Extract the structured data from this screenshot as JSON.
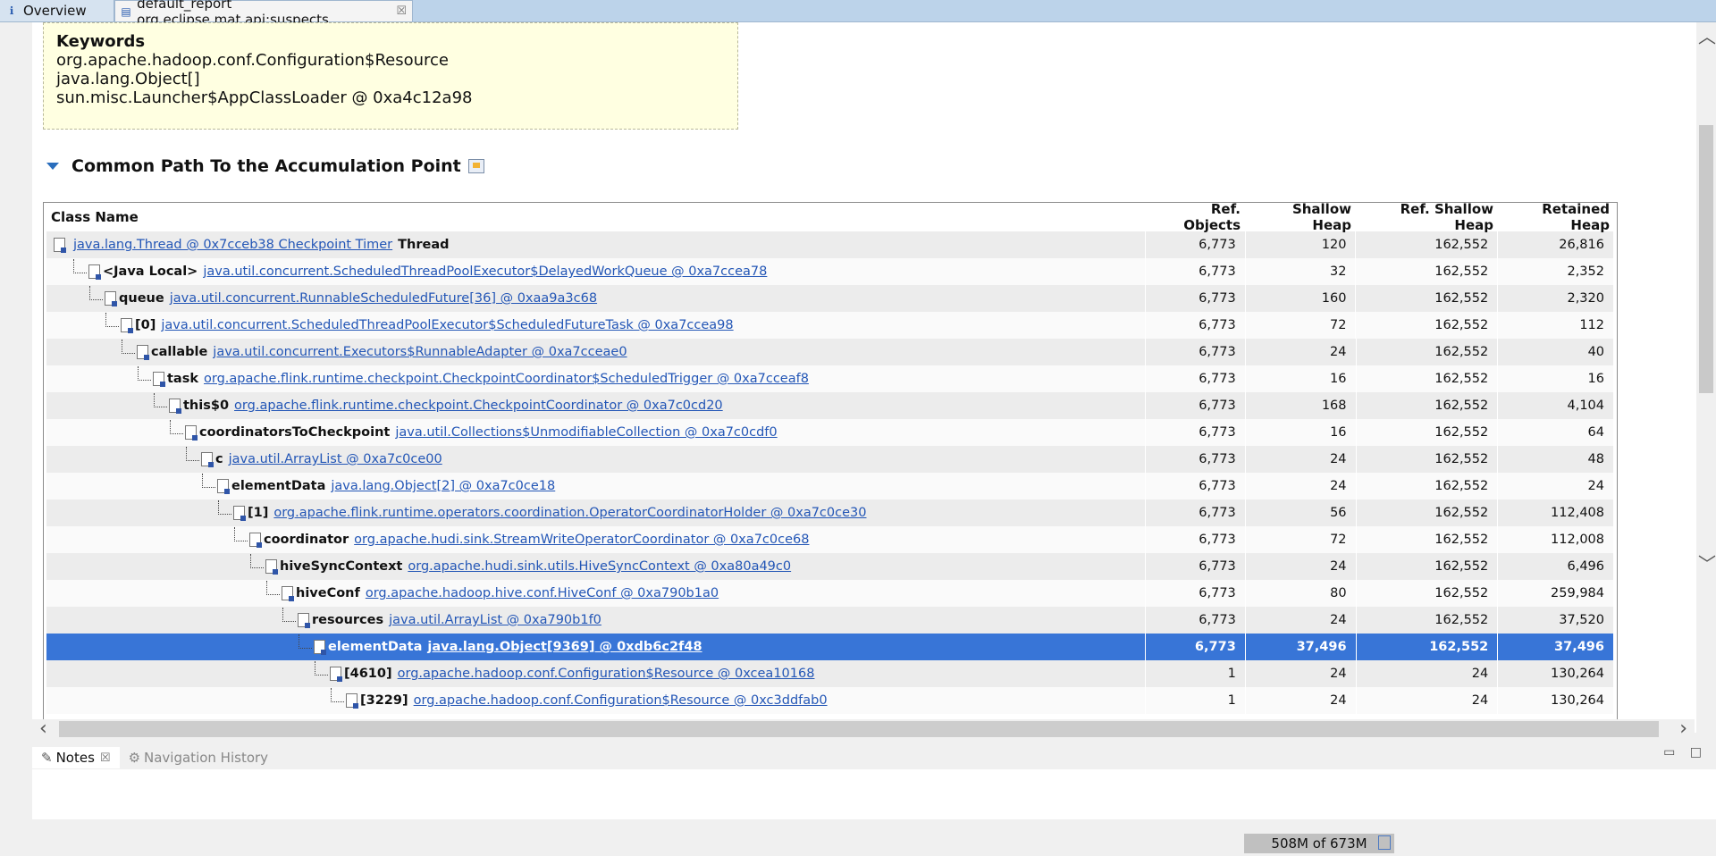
{
  "tabs": [
    {
      "label": "Overview",
      "icon": "info-icon"
    },
    {
      "label": "default_report  org.eclipse.mat.api:suspects",
      "icon": "report-icon",
      "close": "☒"
    }
  ],
  "keywords": {
    "heading": "Keywords",
    "lines": [
      "org.apache.hadoop.conf.Configuration$Resource",
      "java.lang.Object[]",
      "sun.misc.Launcher$AppClassLoader @ 0xa4c12a98"
    ]
  },
  "section": {
    "title": "Common Path To the Accumulation Point"
  },
  "table": {
    "headers": [
      "Class Name",
      "Ref. Objects",
      "Shallow Heap",
      "Ref. Shallow Heap",
      "Retained Heap"
    ],
    "rows": [
      {
        "field": "",
        "link": "java.lang.Thread @ 0x7cceb38 Checkpoint Timer",
        "suffix": "Thread",
        "ref": "6,773",
        "shallow": "120",
        "refsh": "162,552",
        "ret": "26,816"
      },
      {
        "field": "<Java Local>",
        "link": "java.util.concurrent.ScheduledThreadPoolExecutor$DelayedWorkQueue @ 0xa7ccea78",
        "suffix": "",
        "ref": "6,773",
        "shallow": "32",
        "refsh": "162,552",
        "ret": "2,352"
      },
      {
        "field": "queue",
        "link": "java.util.concurrent.RunnableScheduledFuture[36] @ 0xaa9a3c68",
        "suffix": "",
        "ref": "6,773",
        "shallow": "160",
        "refsh": "162,552",
        "ret": "2,320"
      },
      {
        "field": "[0]",
        "link": "java.util.concurrent.ScheduledThreadPoolExecutor$ScheduledFutureTask @ 0xa7ccea98",
        "suffix": "",
        "ref": "6,773",
        "shallow": "72",
        "refsh": "162,552",
        "ret": "112"
      },
      {
        "field": "callable",
        "link": "java.util.concurrent.Executors$RunnableAdapter @ 0xa7cceae0",
        "suffix": "",
        "ref": "6,773",
        "shallow": "24",
        "refsh": "162,552",
        "ret": "40"
      },
      {
        "field": "task",
        "link": "org.apache.flink.runtime.checkpoint.CheckpointCoordinator$ScheduledTrigger @ 0xa7cceaf8",
        "suffix": "",
        "ref": "6,773",
        "shallow": "16",
        "refsh": "162,552",
        "ret": "16"
      },
      {
        "field": "this$0",
        "link": "org.apache.flink.runtime.checkpoint.CheckpointCoordinator @ 0xa7c0cd20",
        "suffix": "",
        "ref": "6,773",
        "shallow": "168",
        "refsh": "162,552",
        "ret": "4,104"
      },
      {
        "field": "coordinatorsToCheckpoint",
        "link": "java.util.Collections$UnmodifiableCollection @ 0xa7c0cdf0",
        "suffix": "",
        "ref": "6,773",
        "shallow": "16",
        "refsh": "162,552",
        "ret": "64"
      },
      {
        "field": "c",
        "link": "java.util.ArrayList @ 0xa7c0ce00",
        "suffix": "",
        "ref": "6,773",
        "shallow": "24",
        "refsh": "162,552",
        "ret": "48"
      },
      {
        "field": "elementData",
        "link": "java.lang.Object[2] @ 0xa7c0ce18",
        "suffix": "",
        "ref": "6,773",
        "shallow": "24",
        "refsh": "162,552",
        "ret": "24"
      },
      {
        "field": "[1]",
        "link": "org.apache.flink.runtime.operators.coordination.OperatorCoordinatorHolder @ 0xa7c0ce30",
        "suffix": "",
        "ref": "6,773",
        "shallow": "56",
        "refsh": "162,552",
        "ret": "112,408"
      },
      {
        "field": "coordinator",
        "link": "org.apache.hudi.sink.StreamWriteOperatorCoordinator @ 0xa7c0ce68",
        "suffix": "",
        "ref": "6,773",
        "shallow": "72",
        "refsh": "162,552",
        "ret": "112,008"
      },
      {
        "field": "hiveSyncContext",
        "link": "org.apache.hudi.sink.utils.HiveSyncContext @ 0xa80a49c0",
        "suffix": "",
        "ref": "6,773",
        "shallow": "24",
        "refsh": "162,552",
        "ret": "6,496"
      },
      {
        "field": "hiveConf",
        "link": "org.apache.hadoop.hive.conf.HiveConf @ 0xa790b1a0",
        "suffix": "",
        "ref": "6,773",
        "shallow": "80",
        "refsh": "162,552",
        "ret": "259,984"
      },
      {
        "field": "resources",
        "link": "java.util.ArrayList @ 0xa790b1f0",
        "suffix": "",
        "ref": "6,773",
        "shallow": "24",
        "refsh": "162,552",
        "ret": "37,520"
      },
      {
        "field": "elementData",
        "link": "java.lang.Object[9369] @ 0xdb6c2f48",
        "suffix": "",
        "ref": "6,773",
        "shallow": "37,496",
        "refsh": "162,552",
        "ret": "37,496"
      },
      {
        "field": "[4610]",
        "link": "org.apache.hadoop.conf.Configuration$Resource @ 0xcea10168",
        "suffix": "",
        "ref": "1",
        "shallow": "24",
        "refsh": "24",
        "ret": "130,264"
      },
      {
        "field": "[3229]",
        "link": "org.apache.hadoop.conf.Configuration$Resource @ 0xc3ddfab0",
        "suffix": "",
        "ref": "1",
        "shallow": "24",
        "refsh": "24",
        "ret": "130,264"
      }
    ],
    "selected_row": 15
  },
  "bottom_panel": {
    "tabs": [
      {
        "label": "Notes",
        "icon": "notes-icon",
        "active": true,
        "close": "☒"
      },
      {
        "label": "Navigation History",
        "icon": "history-icon",
        "active": false
      }
    ]
  },
  "status": {
    "heap": "508M of 673M"
  },
  "colors": {
    "selection": "#3875d7",
    "link": "#2356b6",
    "tabbar": "#bcd3ea",
    "keywords_bg": "#ffffe1"
  }
}
